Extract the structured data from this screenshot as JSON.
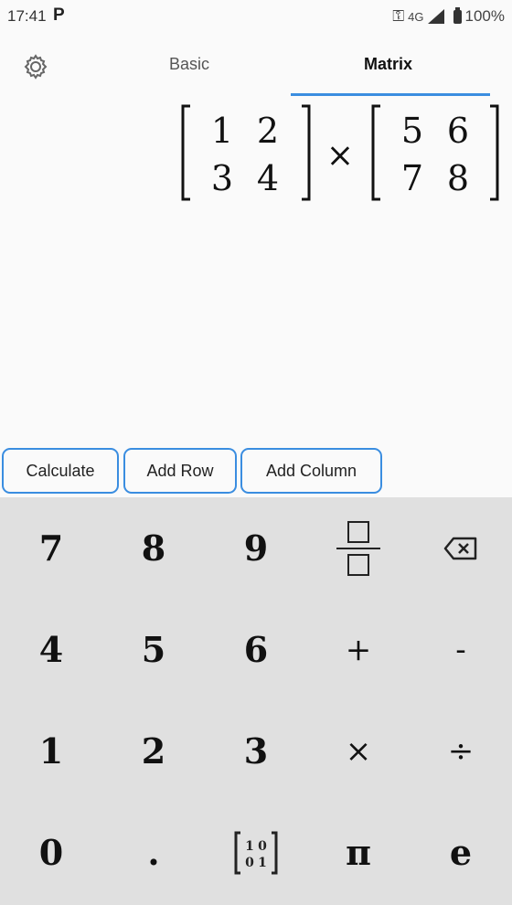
{
  "status": {
    "time": "17:41",
    "network": "4G",
    "battery": "100%"
  },
  "tabs": [
    {
      "label": "Basic"
    },
    {
      "label": "Matrix"
    }
  ],
  "expression": {
    "matrix_a": [
      [
        "1",
        "2"
      ],
      [
        "3",
        "4"
      ]
    ],
    "operator": "×",
    "matrix_b": [
      [
        "5",
        "6"
      ],
      [
        "7",
        "8"
      ]
    ]
  },
  "actions": {
    "calculate": "Calculate",
    "add_row": "Add Row",
    "add_column": "Add Column"
  },
  "keypad": {
    "k7": "7",
    "k8": "8",
    "k9": "9",
    "k4": "4",
    "k5": "5",
    "k6": "6",
    "plus": "+",
    "minus": "-",
    "k1": "1",
    "k2": "2",
    "k3": "3",
    "times": "×",
    "divide": "÷",
    "k0": "0",
    "dot": ".",
    "pi": "π",
    "e": "e",
    "identity": [
      "1",
      "0",
      "0",
      "1"
    ]
  },
  "colors": {
    "accent": "#3a8de0",
    "keypad_bg": "#e0e0e0",
    "background": "#fafafa"
  }
}
